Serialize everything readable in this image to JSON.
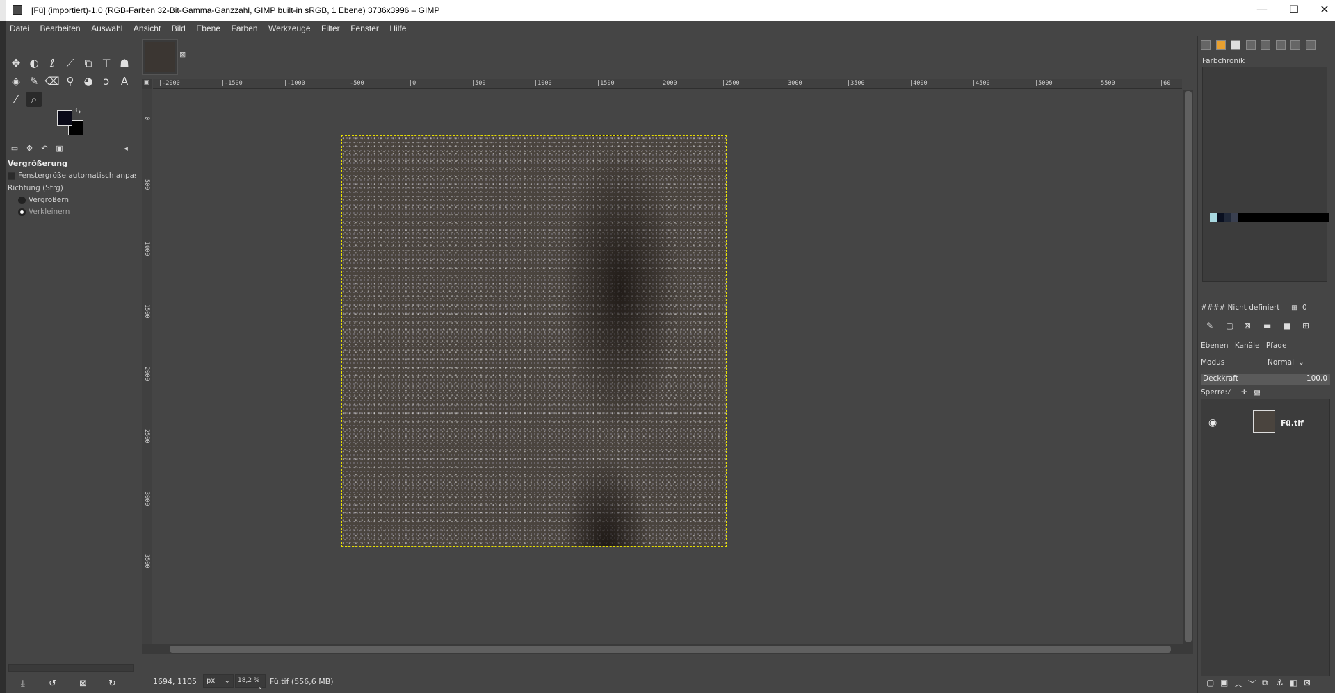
{
  "window": {
    "title": "[Fü] (importiert)-1.0 (RGB-Farben 32-Bit-Gamma-Ganzzahl, GIMP built-in sRGB, 1 Ebene) 3736x3996 – GIMP",
    "minimize": "—",
    "maximize": "☐",
    "close": "✕"
  },
  "menu": [
    "Datei",
    "Bearbeiten",
    "Auswahl",
    "Ansicht",
    "Bild",
    "Ebene",
    "Farben",
    "Werkzeuge",
    "Filter",
    "Fenster",
    "Hilfe"
  ],
  "toolbox": {
    "tools": [
      {
        "name": "move-tool-icon",
        "glyph": "✥"
      },
      {
        "name": "free-select-tool-icon",
        "glyph": "◐"
      },
      {
        "name": "lasso-tool-icon",
        "glyph": "ℓ"
      },
      {
        "name": "fuzzy-select-tool-icon",
        "glyph": "⟋"
      },
      {
        "name": "crop-tool-icon",
        "glyph": "⧉"
      },
      {
        "name": "transform-tool-icon",
        "glyph": "⊤"
      },
      {
        "name": "warp-tool-icon",
        "glyph": "☗"
      },
      {
        "name": "bucket-fill-tool-icon",
        "glyph": "◈"
      },
      {
        "name": "paintbrush-tool-icon",
        "glyph": "✎"
      },
      {
        "name": "eraser-tool-icon",
        "glyph": "⌫"
      },
      {
        "name": "clone-tool-icon",
        "glyph": "⚲"
      },
      {
        "name": "smudge-tool-icon",
        "glyph": "◕"
      },
      {
        "name": "paths-tool-icon",
        "glyph": "ↄ"
      },
      {
        "name": "text-tool-icon",
        "glyph": "A"
      },
      {
        "name": "color-picker-tool-icon",
        "glyph": "⁄"
      },
      {
        "name": "zoom-tool-icon",
        "glyph": "⌕"
      }
    ],
    "options_title": "Vergrößerung",
    "auto_resize_label": "Fenstergröße automatisch anpass",
    "direction_label": "Richtung  (Strg)",
    "zoom_in_label": "Vergrößern",
    "zoom_out_label": "Verkleinern",
    "direction_selected": "Verkleinern"
  },
  "canvas": {
    "ruler_h_labels": [
      "-2000",
      "-1500",
      "-1000",
      "-500",
      "0",
      "500",
      "1000",
      "1500",
      "2000",
      "2500",
      "3000",
      "3500",
      "4000",
      "4500",
      "5000",
      "5500",
      "60"
    ],
    "ruler_v_labels": [
      "0",
      "500",
      "1000",
      "1500",
      "2000",
      "2500",
      "3000",
      "3500"
    ]
  },
  "statusbar": {
    "coords": "1694, 1105",
    "unit": "px",
    "zoom": "18,2 %",
    "file_info": "Fü.tif (556,6 MB)"
  },
  "dock": {
    "colour_history_title": "Farbchronik",
    "hex_label": "####",
    "hex_value": "Nicht definiert",
    "grid_value": "0",
    "swatches": [
      "#a8d8e0",
      "#0a1020",
      "#202838",
      "#3a4050",
      "#000000",
      "#000000",
      "#000000"
    ],
    "layer_tabs": [
      "Ebenen",
      "Kanäle",
      "Pfade"
    ],
    "mode_label": "Modus",
    "mode_value": "Normal",
    "opacity_label": "Deckkraft",
    "opacity_value": "100,0",
    "lock_label": "Sperre:",
    "layer_name": "Fü.tif"
  }
}
